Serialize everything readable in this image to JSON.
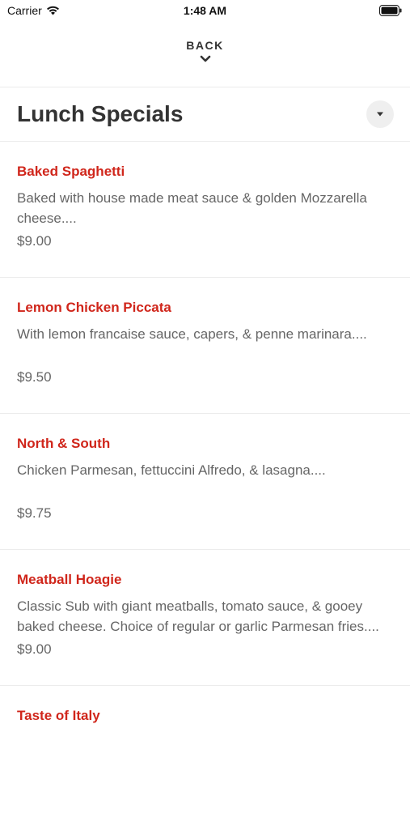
{
  "status_bar": {
    "carrier": "Carrier",
    "time": "1:48 AM",
    "icons": [
      "wifi-icon",
      "battery-icon"
    ]
  },
  "nav": {
    "back_label": "BACK",
    "icon": "chevron-down-icon"
  },
  "section": {
    "title": "Lunch Specials",
    "dropdown_icon": "caret-down-icon"
  },
  "colors": {
    "item_name": "#d0261b",
    "text_secondary": "#666666",
    "divider": "#ececec"
  },
  "menu_items": [
    {
      "name": "Baked Spaghetti",
      "description": "Baked with house made meat sauce & golden Mozzarella cheese....",
      "price": "$9.00"
    },
    {
      "name": "Lemon Chicken Piccata",
      "description": "With lemon francaise sauce, capers, & penne marinara....",
      "price": "$9.50"
    },
    {
      "name": "North & South",
      "description": "Chicken Parmesan, fettuccini Alfredo, & lasagna....",
      "price": "$9.75"
    },
    {
      "name": "Meatball Hoagie",
      "description": "Classic Sub with giant meatballs, tomato sauce, & gooey baked cheese. Choice of regular or garlic Parmesan fries....",
      "price": "$9.00"
    },
    {
      "name": "Taste of Italy",
      "description": "",
      "price": ""
    }
  ]
}
